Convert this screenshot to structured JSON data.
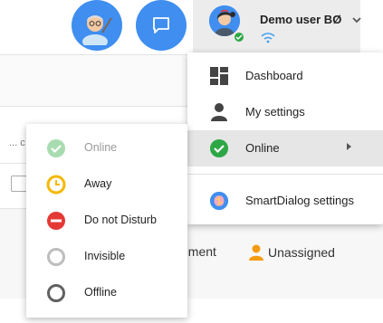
{
  "header": {
    "user_name": "Demo user BØ",
    "avatar_icon": "professor-avatar-icon",
    "chat_icon": "chat-bubble-icon",
    "accent_color": "#3f8ef0"
  },
  "user_menu": {
    "items": [
      {
        "label": "Dashboard",
        "icon": "dashboard-icon"
      },
      {
        "label": "My settings",
        "icon": "person-icon"
      },
      {
        "label": "Online",
        "icon": "check-circle-icon",
        "has_submenu": true
      },
      {
        "label": "SmartDialog settings",
        "icon": "brain-icon"
      }
    ]
  },
  "status_menu": {
    "items": [
      {
        "label": "Online",
        "icon": "check-circle-icon",
        "disabled": true,
        "color": "#a8dcb0"
      },
      {
        "label": "Away",
        "icon": "clock-icon",
        "color": "#f5b800"
      },
      {
        "label": "Do not Disturb",
        "icon": "minus-circle-icon",
        "color": "#e53935"
      },
      {
        "label": "Invisible",
        "icon": "ring-icon",
        "color": "#bdbdbd"
      },
      {
        "label": "Offline",
        "icon": "ring-icon",
        "color": "#616161"
      }
    ]
  },
  "background": {
    "cut_text": "... c",
    "row_text": "ement",
    "assignee": "Unassigned",
    "assignee_color": "#f39c12"
  }
}
